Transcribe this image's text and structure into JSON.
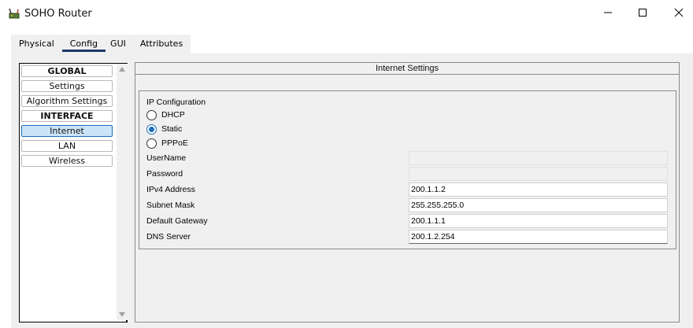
{
  "window": {
    "title": "SOHO Router",
    "icon": "router-icon"
  },
  "tabs": [
    {
      "label": "Physical",
      "active": false
    },
    {
      "label": "Config",
      "active": true
    },
    {
      "label": "GUI",
      "active": false
    },
    {
      "label": "Attributes",
      "active": false
    }
  ],
  "nav": {
    "items": [
      {
        "label": "GLOBAL",
        "type": "header"
      },
      {
        "label": "Settings",
        "type": "item"
      },
      {
        "label": "Algorithm Settings",
        "type": "item"
      },
      {
        "label": "INTERFACE",
        "type": "header"
      },
      {
        "label": "Internet",
        "type": "item",
        "selected": true
      },
      {
        "label": "LAN",
        "type": "item"
      },
      {
        "label": "Wireless",
        "type": "item"
      }
    ]
  },
  "main": {
    "title": "Internet Settings",
    "ip_config": {
      "label": "IP Configuration",
      "options": [
        "DHCP",
        "Static",
        "PPPoE"
      ],
      "selected": "Static"
    },
    "fields": {
      "username": {
        "label": "UserName",
        "value": ""
      },
      "password": {
        "label": "Password",
        "value": ""
      },
      "ipv4": {
        "label": "IPv4 Address",
        "value": "200.1.1.2"
      },
      "subnet": {
        "label": "Subnet Mask",
        "value": "255.255.255.0"
      },
      "gateway": {
        "label": "Default Gateway",
        "value": "200.1.1.1"
      },
      "dns": {
        "label": "DNS Server",
        "value": "200.1.2.254"
      }
    }
  },
  "colors": {
    "accent": "#1b6fb8",
    "selected_bg": "#cce4f7",
    "panel_bg": "#f0f0f0"
  }
}
